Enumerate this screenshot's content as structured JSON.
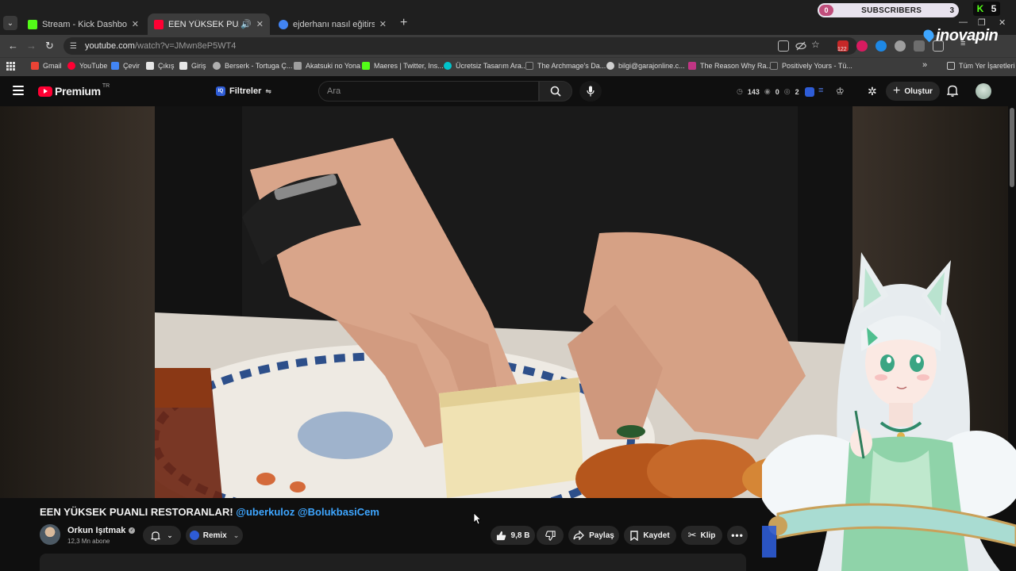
{
  "browser": {
    "tabs": [
      {
        "title": "Stream - Kick Dashboard",
        "active": false,
        "favicon_color": "#53fc18"
      },
      {
        "title": "EEN YÜKSEK PUANLI RESTOR",
        "active": true,
        "favicon_color": "#ff0033"
      },
      {
        "title": "ejderhanı nasıl eğitirsin film - G",
        "active": false,
        "favicon_color": "#4285f4"
      }
    ],
    "url_main": "youtube.com",
    "url_rest": "/watch?v=JMwn8eP5WT4",
    "ext_badge": "122",
    "overlay_logo": "inovapin",
    "bookmarks": [
      {
        "label": "Gmail",
        "color": "#ea4335"
      },
      {
        "label": "YouTube",
        "color": "#ff0033"
      },
      {
        "label": "Çevir",
        "color": "#4285f4"
      },
      {
        "label": "Çıkış",
        "color": "#e6e6e6"
      },
      {
        "label": "Giriş",
        "color": "#e6e6e6"
      },
      {
        "label": "Berserk - Tortuga Ç...",
        "color": "#b0b0b0"
      },
      {
        "label": "Akatsuki no Yona",
        "color": "#9e9e9e"
      },
      {
        "label": "Maeres | Twitter, Ins...",
        "color": "#53fc18"
      },
      {
        "label": "Ücretsiz Tasarım Ara...",
        "color": "#00c4cc"
      },
      {
        "label": "The Archmage's Da...",
        "color": "#333333"
      },
      {
        "label": "bilgi@garajonline.c...",
        "color": "#cfcfcf"
      },
      {
        "label": "The Reason Why Ra...",
        "color": "#c13584"
      },
      {
        "label": "Positively Yours - Tü...",
        "color": "#333333"
      }
    ],
    "bookmarks_more": "»",
    "all_bookmarks": "Tüm Yer İşaretleri"
  },
  "stream_widget": {
    "left_count": "0",
    "label": "SUBSCRIBERS",
    "count": "3",
    "kick_letter": "K",
    "kick_count": "5"
  },
  "youtube": {
    "logo_word": "Premium",
    "logo_country": "TR",
    "filters_label": "Filtreler",
    "search_placeholder": "Ara",
    "stats": {
      "a": "143",
      "b": "0",
      "c": "2"
    },
    "create_label": "Oluştur",
    "video": {
      "title_main": "EEN YÜKSEK PUANLI RESTORANLAR!",
      "mention_1": "@uberkuloz",
      "mention_2": "@BolukbasiCem",
      "channel_name": "Orkun Işıtmak",
      "subscribers": "12,3 Mn abone",
      "remix_label": "Remix",
      "likes": "9,8 B",
      "share_label": "Paylaş",
      "save_label": "Kaydet",
      "clip_label": "Klip"
    }
  },
  "colors": {
    "yt_red": "#ff0033",
    "link_blue": "#3ea6ff",
    "kick_green": "#53fc18",
    "background": "#0f0f0f"
  }
}
